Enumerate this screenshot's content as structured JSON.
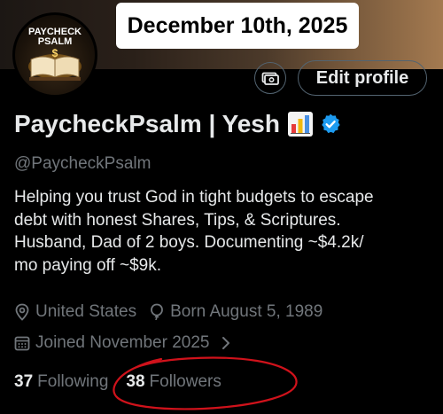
{
  "overlay": {
    "date": "December 10th, 2025"
  },
  "avatar": {
    "line1": "PAYCHECK",
    "line2": "PSALM"
  },
  "actions": {
    "edit_profile": "Edit profile"
  },
  "profile": {
    "display_name": "PaycheckPsalm | Yesh",
    "handle": "@PaycheckPsalm",
    "bio_lines": [
      "Helping you trust God in tight budgets to escape",
      "debt with honest Shares, Tips, & Scriptures.",
      "Husband, Dad of 2 boys. Documenting ~$4.2k/",
      "mo paying off ~$9k."
    ],
    "location": "United States",
    "born": "Born August 5, 1989",
    "joined": "Joined November 2025"
  },
  "stats": {
    "following_count": "37",
    "following_label": "Following",
    "followers_count": "38",
    "followers_label": "Followers"
  },
  "colors": {
    "verified": "#1d9bf0",
    "annotation": "#d0121b",
    "muted": "#71767b"
  }
}
